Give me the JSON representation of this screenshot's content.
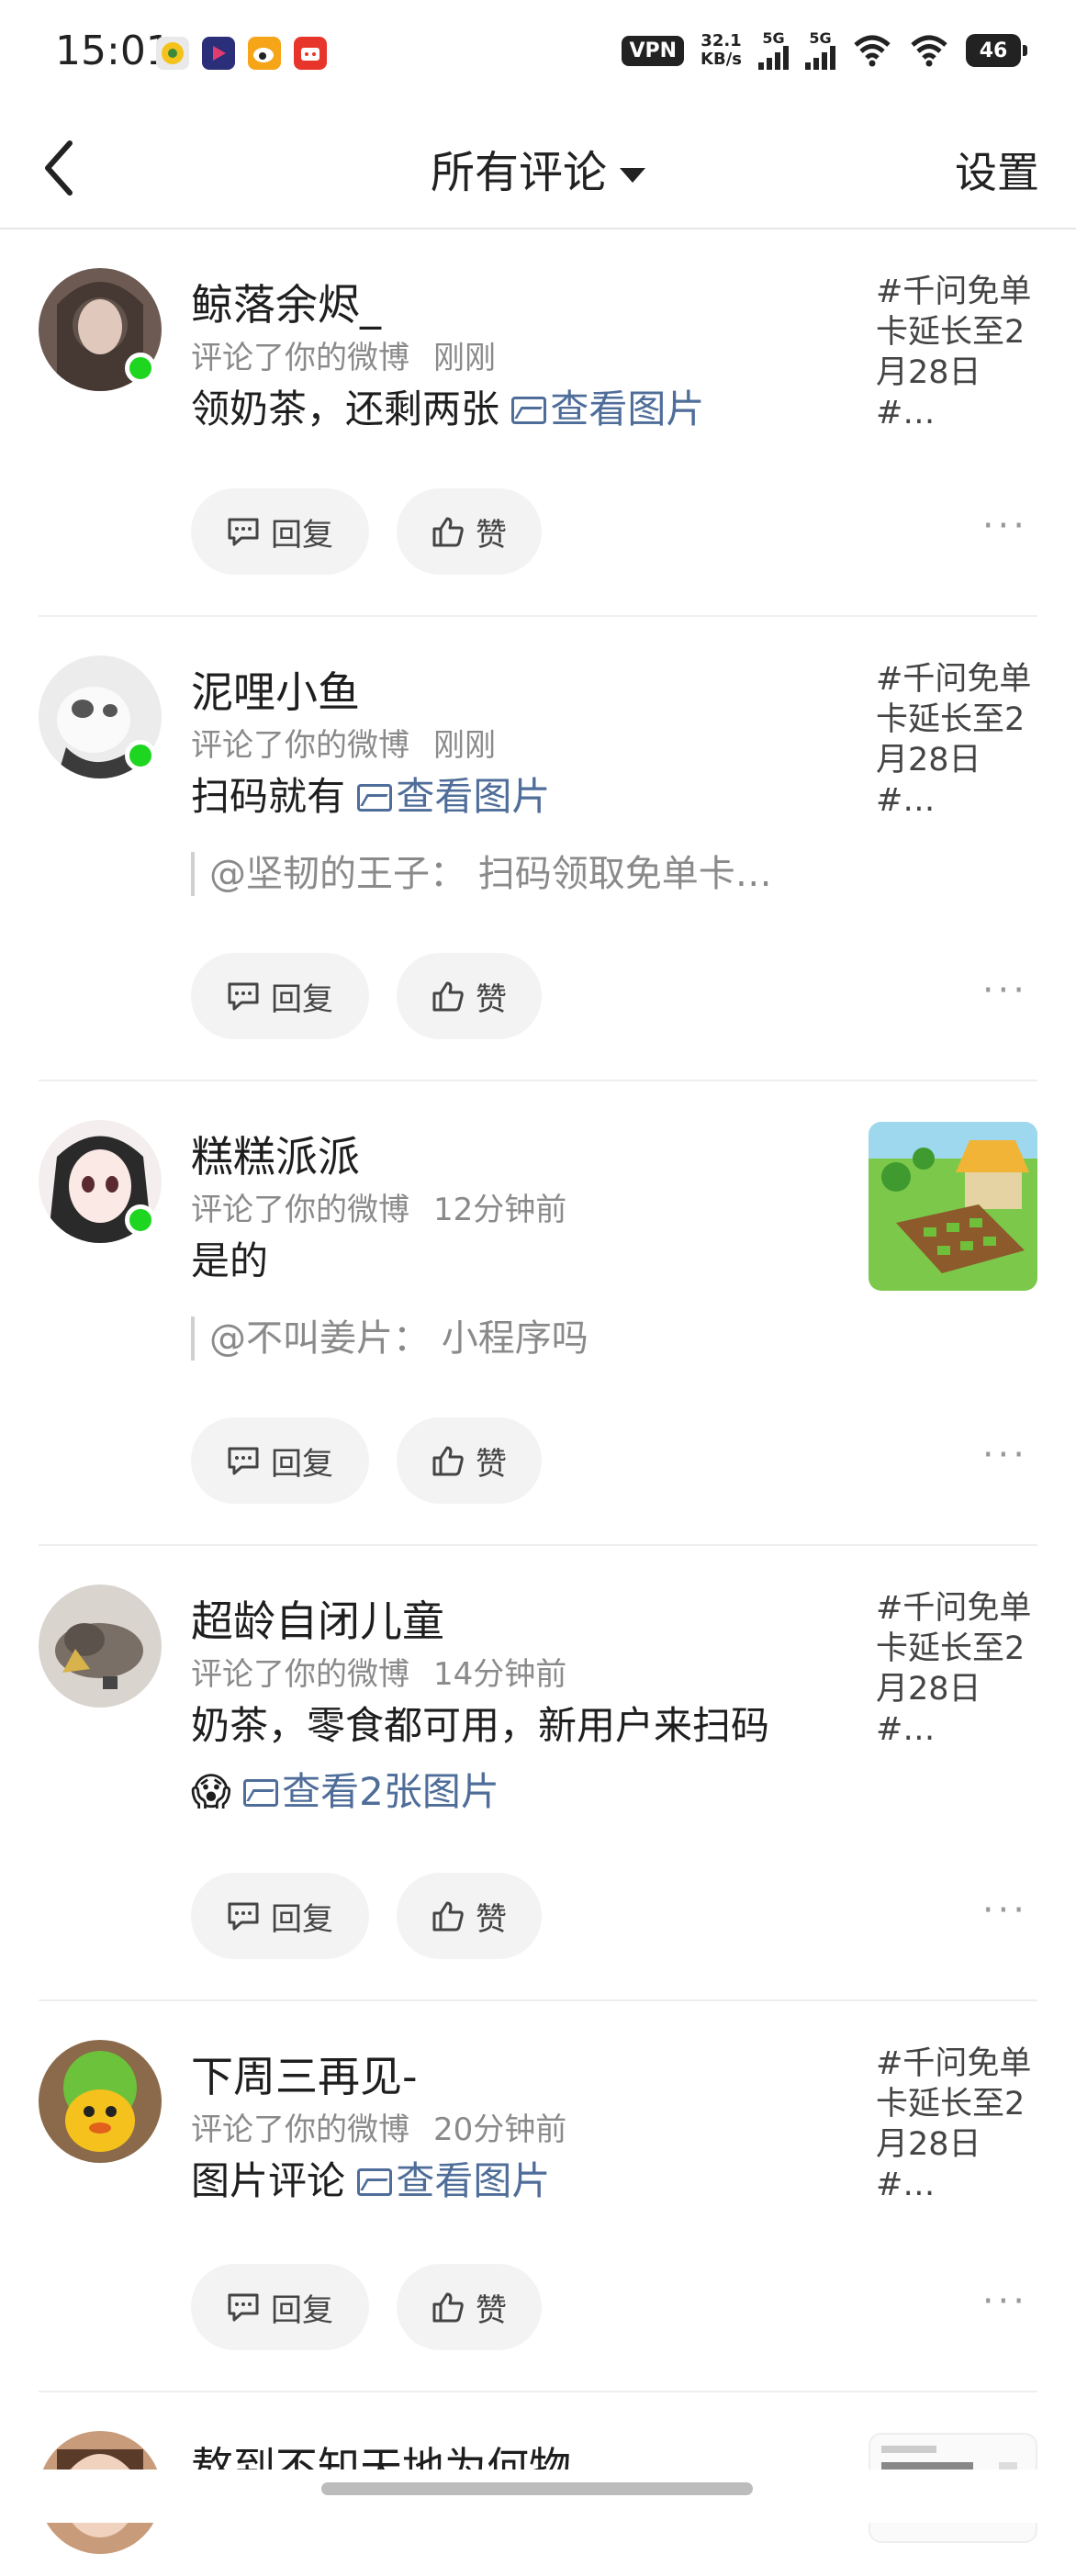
{
  "status_bar": {
    "time": "15:01",
    "vpn": "VPN",
    "speed_value": "32.1",
    "speed_unit": "KB/s",
    "signal1": "5G",
    "signal2": "5G",
    "battery": "46"
  },
  "nav": {
    "title": "所有评论",
    "settings": "设置"
  },
  "comments": [
    {
      "name": "鲸落余烬_",
      "action": "评论了你的微博",
      "time": "刚刚",
      "text": "领奶茶，还剩两张",
      "link": "查看图片",
      "topic": "#千问免单卡延长至2月28日#…",
      "reply_label": "回复",
      "like_label": "赞"
    },
    {
      "name": "泥哩小鱼",
      "action": "评论了你的微博",
      "time": "刚刚",
      "text": "扫码就有",
      "link": "查看图片",
      "quote": "@坚韧的王子： 扫码领取免单卡…",
      "topic": "#千问免单卡延长至2月28日#…",
      "reply_label": "回复",
      "like_label": "赞"
    },
    {
      "name": "糕糕派派",
      "action": "评论了你的微博",
      "time": "12分钟前",
      "text": "是的",
      "quote": "@不叫姜片： 小程序吗",
      "reply_label": "回复",
      "like_label": "赞"
    },
    {
      "name": "超龄自闭儿童",
      "action": "评论了你的微博",
      "time": "14分钟前",
      "text": "奶茶，零食都可用，新用户来扫码",
      "emoji": "😱",
      "link": "查看2张图片",
      "topic": "#千问免单卡延长至2月28日#…",
      "reply_label": "回复",
      "like_label": "赞"
    },
    {
      "name": "下周三再见-",
      "action": "评论了你的微博",
      "time": "20分钟前",
      "text": "图片评论",
      "link": "查看图片",
      "topic": "#千问免单卡延长至2月28日#…",
      "reply_label": "回复",
      "like_label": "赞"
    },
    {
      "name": "熬到不知天地为何物"
    }
  ],
  "more_label": "···"
}
